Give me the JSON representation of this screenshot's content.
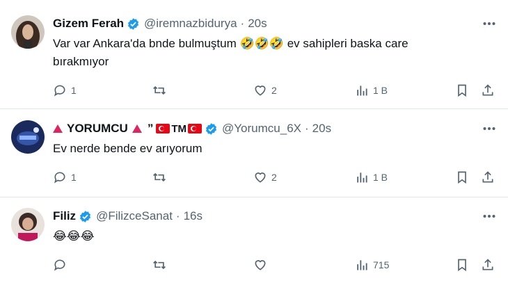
{
  "colors": {
    "verified": "#1d9bf0",
    "text_secondary": "#536471",
    "text_primary": "#0f1419",
    "divider": "#e6e9ec"
  },
  "tweets": [
    {
      "name": "Gizem Ferah",
      "handle": "@iremnazbidurya",
      "dot": "·",
      "time": "20s",
      "text_line1": "Var var Ankara'da bnde bulmuştum 🤣🤣🤣 ev sahipleri baska care",
      "text_line2": "bırakmıyor",
      "replies": "1",
      "reposts": "",
      "likes": "2",
      "views": "1 B"
    },
    {
      "name_prefix": "YORUMCU",
      "name_suffix": "TM",
      "quote": "”",
      "handle": "@Yorumcu_6X",
      "dot": "·",
      "time": "20s",
      "text_line1": "Ev nerde bende ev arıyorum",
      "replies": "1",
      "reposts": "",
      "likes": "2",
      "views": "1 B"
    },
    {
      "name": "Filiz",
      "handle": "@FilizceSanat",
      "dot": "·",
      "time": "16s",
      "text_line1": "😂😂😂",
      "replies": "",
      "reposts": "",
      "likes": "",
      "views": "715"
    }
  ],
  "icons": {
    "more": "more-horizontal-icon",
    "reply": "reply-bubble-icon",
    "repost": "repost-arrows-icon",
    "like": "heart-icon",
    "views": "views-bar-chart-icon",
    "bookmark": "bookmark-icon",
    "share": "share-upload-icon",
    "verified": "verified-badge-icon"
  }
}
